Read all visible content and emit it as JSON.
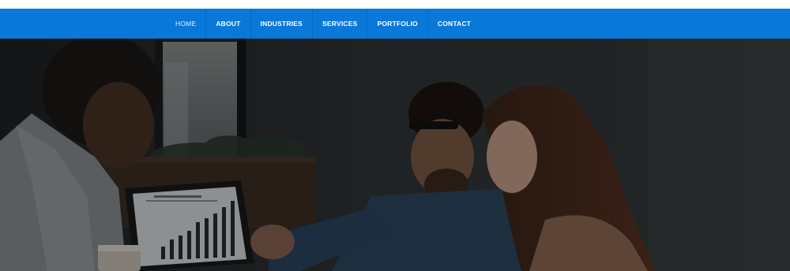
{
  "nav": {
    "items": [
      {
        "label": "HOME",
        "active": true
      },
      {
        "label": "ABOUT",
        "active": false
      },
      {
        "label": "INDUSTRIES",
        "active": false
      },
      {
        "label": "SERVICES",
        "active": false
      },
      {
        "label": "PORTFOLIO",
        "active": false
      },
      {
        "label": "CONTACT",
        "active": false
      }
    ],
    "background_color": "#0a78d8"
  },
  "hero": {
    "image_subject": "three-people-reviewing-bar-chart-on-laptop"
  }
}
